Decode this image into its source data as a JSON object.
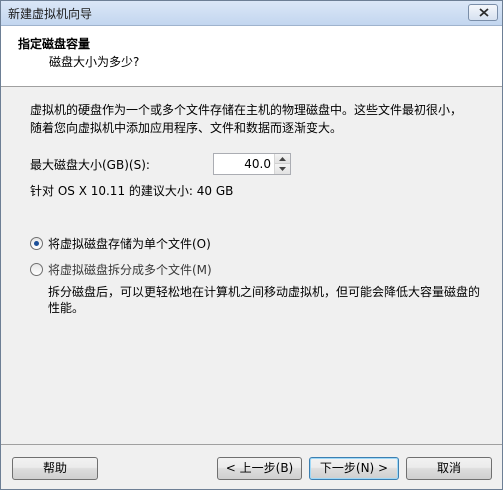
{
  "window": {
    "title": "新建虚拟机向导",
    "close_icon": "close-icon"
  },
  "header": {
    "title": "指定磁盘容量",
    "subtitle": "磁盘大小为多少?"
  },
  "description": "虚拟机的硬盘作为一个或多个文件存储在主机的物理磁盘中。这些文件最初很小，随着您向虚拟机中添加应用程序、文件和数据而逐渐变大。",
  "disk_size": {
    "label": "最大磁盘大小(GB)(S):",
    "value": "40.0"
  },
  "recommendation": "针对 OS X 10.11 的建议大小: 40 GB",
  "options": [
    {
      "label": "将虚拟磁盘存储为单个文件(O)",
      "checked": true
    },
    {
      "label": "将虚拟磁盘拆分成多个文件(M)",
      "checked": false
    }
  ],
  "split_note": "拆分磁盘后，可以更轻松地在计算机之间移动虚拟机，但可能会降低大容量磁盘的性能。",
  "buttons": {
    "help": "帮助",
    "back": "< 上一步(B)",
    "next": "下一步(N) >",
    "cancel": "取消"
  }
}
